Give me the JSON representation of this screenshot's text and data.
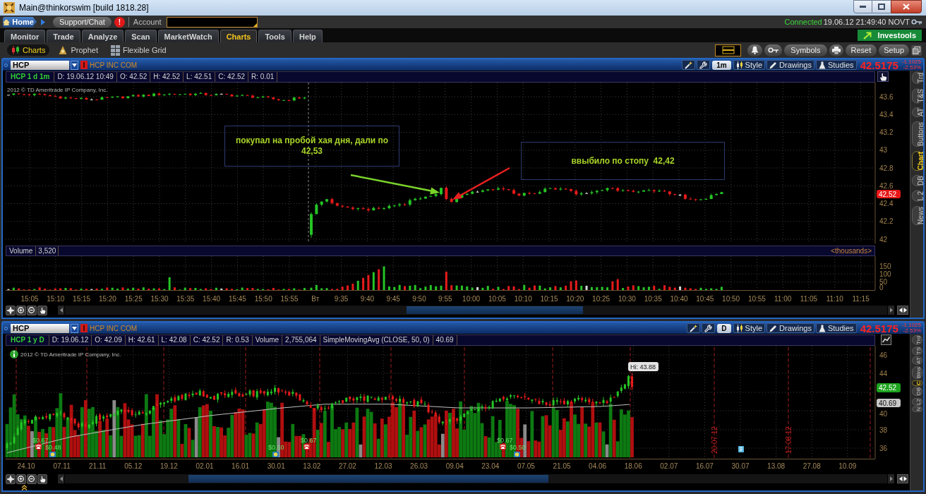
{
  "window": {
    "title": "Main@thinkorswim [build 1818.28]"
  },
  "top_bar": {
    "home": "Home",
    "support": "Support/Chat",
    "alert": "!",
    "account_label": "Account",
    "connection": "Connected",
    "clock": "19.06.12 21:49:40 NOVT"
  },
  "main_tabs": [
    {
      "label": "Monitor",
      "selected": false
    },
    {
      "label": "Trade",
      "selected": false
    },
    {
      "label": "Analyze",
      "selected": false
    },
    {
      "label": "Scan",
      "selected": false
    },
    {
      "label": "MarketWatch",
      "selected": false
    },
    {
      "label": "Charts",
      "selected": true
    },
    {
      "label": "Tools",
      "selected": false
    },
    {
      "label": "Help",
      "selected": false
    }
  ],
  "investools": "Investools",
  "sub_tabs": [
    {
      "label": "Charts",
      "selected": true
    },
    {
      "label": "Prophet",
      "selected": false
    },
    {
      "label": "Flexible Grid",
      "selected": false
    }
  ],
  "toolbar": {
    "symbols": "Symbols",
    "reset": "Reset",
    "setup": "Setup"
  },
  "charts": [
    {
      "kind": "intraday",
      "symbol": "HCP",
      "description": "HCP INC COM",
      "aggregation": "1m",
      "style": "Style",
      "drawings": "Drawings",
      "studies": "Studies",
      "last": "42.5175",
      "change": "-1.1025",
      "change_percent": "-2.53%",
      "info": [
        "HCP 1 d 1m",
        "D: 19.06.12 10:49",
        "O: 42.52",
        "H: 42.52",
        "L: 42.51",
        "C: 42.52",
        "R: 0.01"
      ],
      "copyright": "2012 © TD Ameritrade IP Company, Inc.",
      "price_axis": [
        "43.6",
        "43.4",
        "43.2",
        "43",
        "42.8",
        "42.6",
        "42.4",
        "42.2",
        "42"
      ],
      "last_price_tag": "42.52",
      "notes": [
        "покупал на пробой хая дня, дали по 42,53",
        "ввыбило по стопу  42,42"
      ],
      "volume": {
        "label": "Volume",
        "value": "3,520",
        "unit": "<thousands>",
        "axis": [
          "150",
          "100",
          "50",
          "0"
        ]
      },
      "time_axis": [
        "15:05",
        "15:10",
        "15:15",
        "15:20",
        "15:25",
        "15:30",
        "15:35",
        "15:40",
        "15:45",
        "15:50",
        "15:55",
        "Вт",
        "9:35",
        "9:40",
        "9:45",
        "9:50",
        "9:55",
        "10:00",
        "10:05",
        "10:10",
        "10:15",
        "10:20",
        "10:25",
        "10:30",
        "10:35",
        "10:40",
        "10:45",
        "10:50",
        "10:55",
        "11:00",
        "11:05",
        "11:10",
        "11:15"
      ],
      "side_tabs": [
        {
          "label": "Trd",
          "selected": false
        },
        {
          "label": "T&S",
          "selected": false
        },
        {
          "label": "AT",
          "selected": false
        },
        {
          "label": "Buttons",
          "selected": false
        },
        {
          "label": "Chart",
          "selected": true
        },
        {
          "label": "DB",
          "selected": false
        },
        {
          "label": "L 2",
          "selected": false
        },
        {
          "label": "News",
          "selected": false
        }
      ]
    },
    {
      "kind": "daily",
      "symbol": "HCP",
      "description": "HCP INC COM",
      "aggregation": "D",
      "style": "Style",
      "drawings": "Drawings",
      "studies": "Studies",
      "last": "42.5175",
      "change": "-1.1025",
      "change_percent": "-2.53%",
      "info": [
        "HCP 1 y D",
        "D: 19.06.12",
        "O: 42.09",
        "H: 42.61",
        "L: 42.08",
        "C: 42.52",
        "R: 0.53",
        "Volume",
        "2,755,064",
        "SimpleMovingAvg (CLOSE, 50, 0)",
        "40.69"
      ],
      "copyright": "2012 © TD Ameritrade IP Company, Inc.",
      "high_label": "Hi: 43.88",
      "price_axis": [
        "46",
        "44",
        "40",
        "38",
        "36"
      ],
      "last_price_tag": "42.52",
      "average_tag": "40.69",
      "dividends": [
        "$0.67",
        "$0.48",
        "$0.50",
        "$0.67",
        "$0.67",
        "$0.50"
      ],
      "event_dates": [
        "20.07.12",
        "17.08.12"
      ],
      "date_axis": [
        "24.10",
        "07.11",
        "21.11",
        "05.12",
        "19.12",
        "02.01",
        "16.01",
        "30.01",
        "13.02",
        "27.02",
        "12.03",
        "26.03",
        "09.04",
        "23.04",
        "07.05",
        "21.05",
        "04.06",
        "18.06",
        "02.07",
        "16.07",
        "30.07",
        "13.08",
        "27.08",
        "10.09"
      ],
      "side_tabs": [
        {
          "label": "Trd",
          "selected": false
        },
        {
          "label": "TS",
          "selected": false
        },
        {
          "label": "AT",
          "selected": false
        },
        {
          "label": "Btns",
          "selected": false
        },
        {
          "label": "C",
          "selected": true
        },
        {
          "label": "DB",
          "selected": false
        },
        {
          "label": "L2",
          "selected": false
        },
        {
          "label": "N",
          "selected": false
        }
      ]
    }
  ]
}
